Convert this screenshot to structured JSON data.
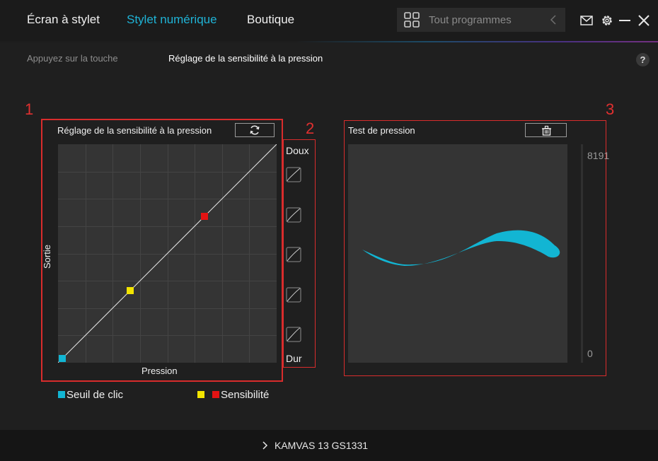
{
  "nav": {
    "tabs": [
      {
        "label": "Écran à stylet",
        "active": false
      },
      {
        "label": "Stylet numérique",
        "active": true
      },
      {
        "label": "Boutique",
        "active": false
      }
    ],
    "search": {
      "icon": "grid-icon",
      "placeholder": "Tout programmes"
    },
    "icons": [
      "mail-icon",
      "gear-icon",
      "minimize-icon",
      "close-icon"
    ]
  },
  "subtabs": [
    {
      "label": "Appuyez sur la touche",
      "active": false
    },
    {
      "label": "Réglage de la sensibilité à la pression",
      "active": true
    }
  ],
  "help": {
    "label": "?"
  },
  "callouts": [
    "1",
    "2",
    "3"
  ],
  "curve_panel": {
    "title": "Réglage de la sensibilité à la pression",
    "reset_icon": "refresh-icon",
    "x_label": "Pression",
    "y_label": "Sortie",
    "curve": [
      [
        0,
        0
      ],
      [
        1,
        1
      ]
    ],
    "handles": [
      {
        "name": "click-threshold",
        "color": "#12b5d3",
        "pressure": 0.02,
        "output": 0.02
      },
      {
        "name": "sensitivity-low",
        "color": "#f2e400",
        "pressure": 0.33,
        "output": 0.33
      },
      {
        "name": "sensitivity-high",
        "color": "#e31313",
        "pressure": 0.67,
        "output": 0.67
      }
    ]
  },
  "presets": {
    "top_label": "Doux",
    "bottom_label": "Dur",
    "items": [
      {
        "name": "preset-softest",
        "curvature": -0.9
      },
      {
        "name": "preset-soft",
        "curvature": -0.45
      },
      {
        "name": "preset-linear",
        "curvature": 0
      },
      {
        "name": "preset-hard",
        "curvature": 0.45
      },
      {
        "name": "preset-hardest",
        "curvature": 0.9
      }
    ]
  },
  "legend": [
    {
      "label": "Seuil de clic",
      "colors": [
        "#12b5d3"
      ]
    },
    {
      "label": "Sensibilité",
      "colors": [
        "#f2e400",
        "#e31313"
      ]
    }
  ],
  "test_panel": {
    "title": "Test de pression",
    "clear_icon": "trash-icon",
    "max_value": "8191",
    "min_value": "0",
    "current_pressure": 0,
    "stroke_color": "#12b5d3"
  },
  "footer": {
    "device": "KAMVAS 13 GS1331",
    "chevron_icon": "chevron-right-icon"
  },
  "colors": {
    "accent": "#1fb3d6",
    "highlight": "#d92c2c",
    "background": "#1f1f1f"
  }
}
